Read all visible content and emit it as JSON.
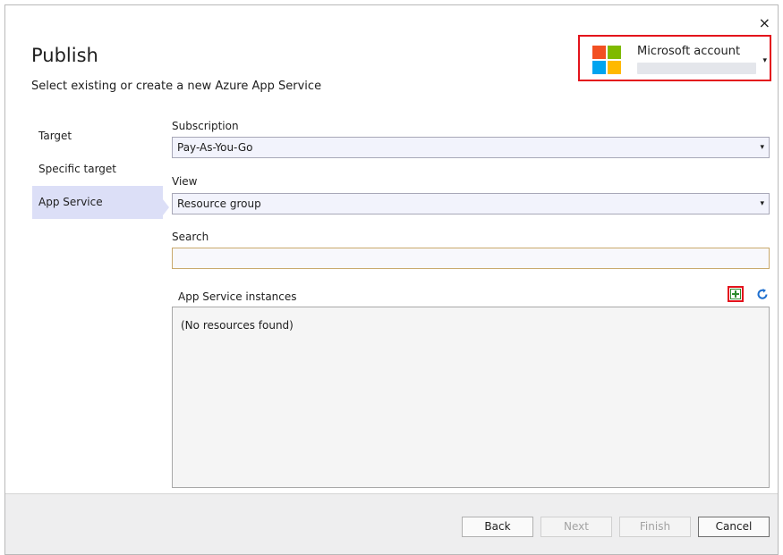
{
  "dialog": {
    "title": "Publish",
    "subtitle": "Select existing or create a new Azure App Service",
    "close_glyph": "×"
  },
  "account": {
    "label": "Microsoft account",
    "logo_icon": "microsoft-logo",
    "logo_colors": [
      "#f25022",
      "#7fba00",
      "#00a4ef",
      "#ffb900"
    ],
    "caret_glyph": "▾"
  },
  "nav": {
    "items": [
      {
        "label": "Target",
        "selected": false
      },
      {
        "label": "Specific target",
        "selected": false
      },
      {
        "label": "App Service",
        "selected": true
      }
    ]
  },
  "form": {
    "subscription_label": "Subscription",
    "subscription_value": "Pay-As-You-Go",
    "view_label": "View",
    "view_value": "Resource group",
    "search_label": "Search",
    "search_value": "",
    "caret_glyph": "▾"
  },
  "instances": {
    "label": "App Service instances",
    "empty_text": "(No resources found)",
    "add_icon": "plus-icon",
    "refresh_icon": "refresh-icon"
  },
  "footer": {
    "back_label": "Back",
    "next_label": "Next",
    "finish_label": "Finish",
    "cancel_label": "Cancel"
  },
  "colors": {
    "highlight_border": "#e3131c",
    "selected_nav": "#dcdff7",
    "add_icon": "#2e8b2e",
    "refresh_icon": "#1e6fcf"
  }
}
